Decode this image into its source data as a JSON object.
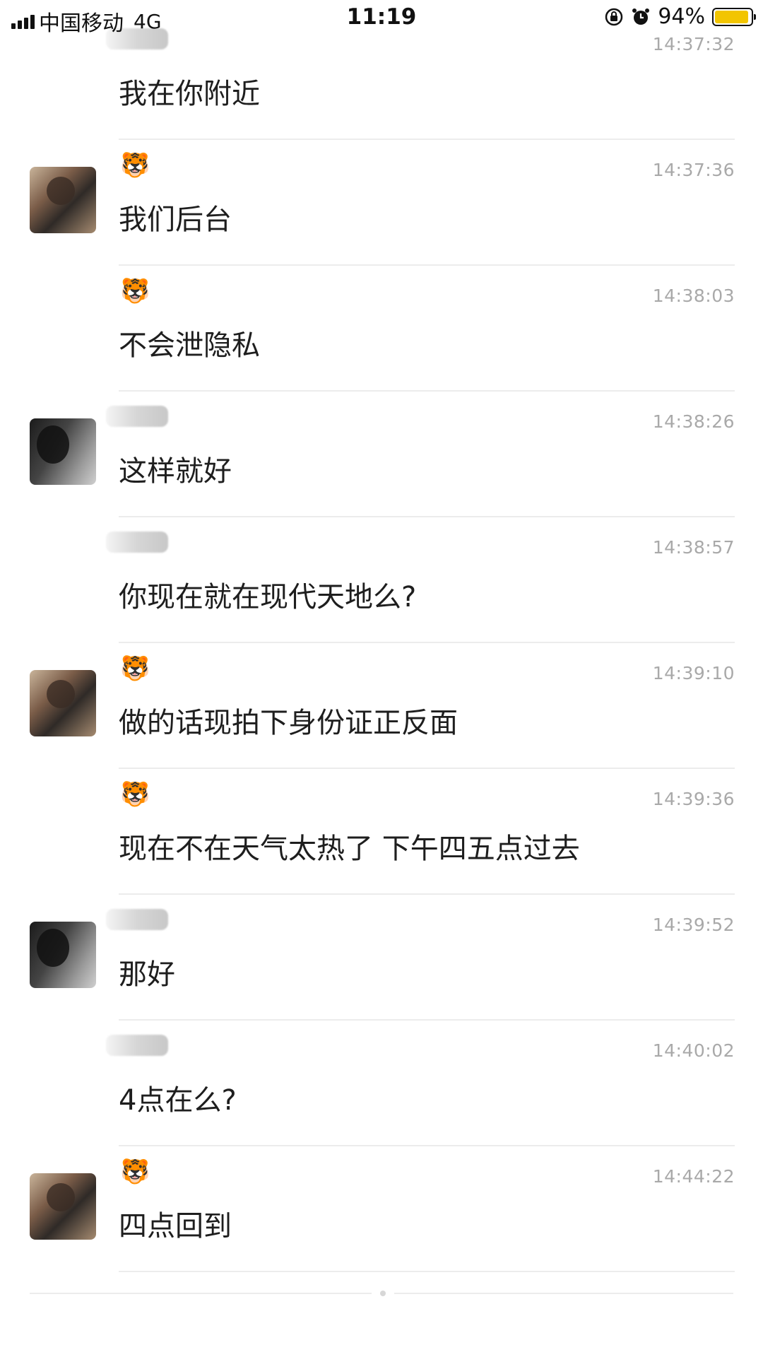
{
  "status_bar": {
    "carrier": "中国移动",
    "network": "4G",
    "time": "11:19",
    "battery_percent": "94%",
    "battery_level": 0.94,
    "battery_color": "#f2c500",
    "icons": [
      "signal-icon",
      "orientation-lock-icon",
      "alarm-icon",
      "battery-icon"
    ]
  },
  "messages": [
    {
      "sender": "blurred-name",
      "avatar": "none",
      "time": "14:37:32",
      "text": "我在你附近"
    },
    {
      "sender": "tiger",
      "sender_label": "🐯",
      "avatar": "a",
      "time": "14:37:36",
      "text": "我们后台"
    },
    {
      "sender": "tiger",
      "sender_label": "🐯",
      "avatar": "none",
      "time": "14:38:03",
      "text": "不会泄隐私"
    },
    {
      "sender": "blurred-name",
      "avatar": "b",
      "time": "14:38:26",
      "text": "这样就好"
    },
    {
      "sender": "blurred-name",
      "avatar": "none",
      "time": "14:38:57",
      "text": "你现在就在现代天地么?"
    },
    {
      "sender": "tiger",
      "sender_label": "🐯",
      "avatar": "a",
      "time": "14:39:10",
      "text": "做的话现拍下身份证正反面"
    },
    {
      "sender": "tiger",
      "sender_label": "🐯",
      "avatar": "none",
      "time": "14:39:36",
      "text": "现在不在天气太热了  下午四五点过去"
    },
    {
      "sender": "blurred-name",
      "avatar": "b",
      "time": "14:39:52",
      "text": "那好"
    },
    {
      "sender": "blurred-name",
      "avatar": "none",
      "time": "14:40:02",
      "text": "4点在么?"
    },
    {
      "sender": "tiger",
      "sender_label": "🐯",
      "avatar": "a",
      "time": "14:44:22",
      "text": "四点回到"
    }
  ]
}
